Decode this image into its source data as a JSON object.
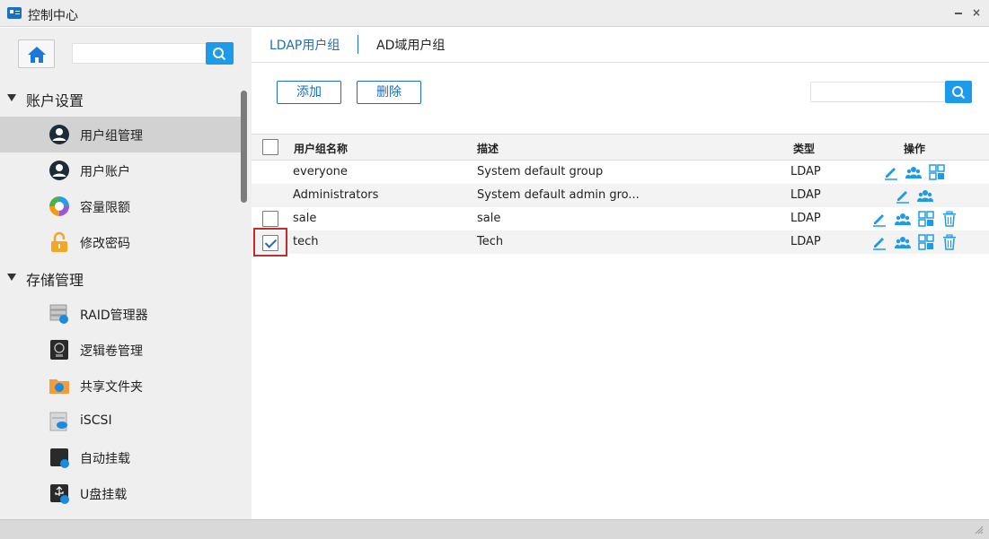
{
  "window": {
    "title": "控制中心",
    "minimize_icon": "minimize-icon",
    "close_icon": "close-icon",
    "close_glyph": "×"
  },
  "sidebar": {
    "search": {
      "value": "",
      "placeholder": ""
    },
    "sections": [
      {
        "label": "账户设置",
        "items": [
          {
            "label": "用户组管理",
            "icon": "user-group-icon",
            "active": true
          },
          {
            "label": "用户账户",
            "icon": "user-account-icon"
          },
          {
            "label": "容量限额",
            "icon": "quota-pie-icon"
          },
          {
            "label": "修改密码",
            "icon": "lock-icon"
          }
        ]
      },
      {
        "label": "存储管理",
        "items": [
          {
            "label": "RAID管理器",
            "icon": "raid-icon"
          },
          {
            "label": "逻辑卷管理",
            "icon": "lvm-icon"
          },
          {
            "label": "共享文件夹",
            "icon": "shared-folder-icon"
          },
          {
            "label": "iSCSI",
            "icon": "iscsi-icon"
          },
          {
            "label": "自动挂载",
            "icon": "auto-mount-icon"
          },
          {
            "label": "U盘挂载",
            "icon": "usb-mount-icon"
          }
        ]
      }
    ]
  },
  "main": {
    "tabs": [
      {
        "label": "LDAP用户组",
        "active": true
      },
      {
        "label": "AD域用户组",
        "active": false
      }
    ],
    "toolbar": {
      "add_label": "添加",
      "delete_label": "删除"
    },
    "search": {
      "value": "",
      "placeholder": ""
    },
    "table": {
      "columns": [
        "用户组名称",
        "描述",
        "类型",
        "操作"
      ],
      "rows": [
        {
          "name": "everyone",
          "description": "System default group",
          "type": "LDAP",
          "checkbox": false,
          "checked": false,
          "ops": [
            "edit",
            "members",
            "permissions"
          ]
        },
        {
          "name": "Administrators",
          "description": "System default admin gro...",
          "type": "LDAP",
          "checkbox": false,
          "checked": false,
          "ops": [
            "edit",
            "members"
          ]
        },
        {
          "name": "sale",
          "description": "sale",
          "type": "LDAP",
          "checkbox": true,
          "checked": false,
          "ops": [
            "edit",
            "members",
            "permissions",
            "delete"
          ]
        },
        {
          "name": "tech",
          "description": "Tech",
          "type": "LDAP",
          "checkbox": true,
          "checked": true,
          "ops": [
            "edit",
            "members",
            "permissions",
            "delete"
          ]
        }
      ]
    }
  },
  "colors": {
    "accent": "#1a6fc1",
    "search_button": "#1e9be8",
    "highlight": "#c42b2b",
    "active_nav": "#d2d2d2"
  }
}
